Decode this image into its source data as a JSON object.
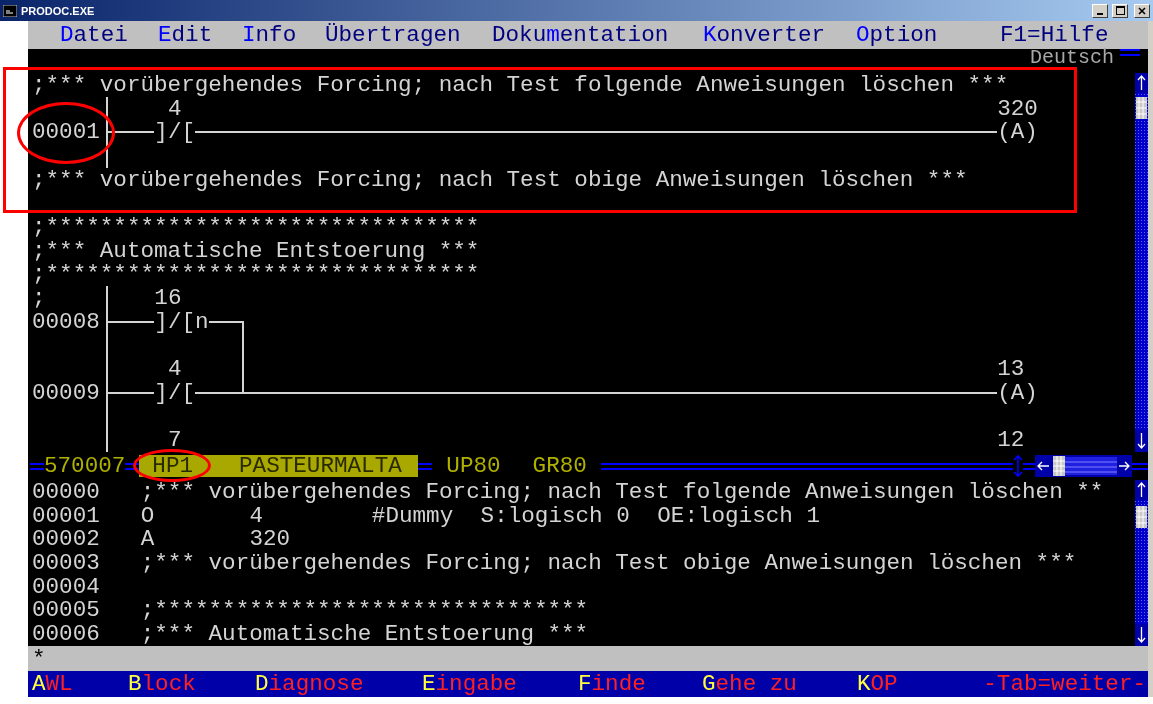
{
  "window": {
    "title": "PRODOC.EXE"
  },
  "menu": [
    {
      "hot": "D",
      "rest": "atei"
    },
    {
      "hot": "E",
      "rest": "dit"
    },
    {
      "hot": "I",
      "rest": "nfo"
    },
    {
      "rest": "Übertragen"
    },
    {
      "pre": "Doku",
      "hot": "m",
      "rest": "entation"
    },
    {
      "hot": "K",
      "rest": "onverter"
    },
    {
      "hot": "O",
      "rest": "ption"
    },
    {
      "rest": "F1=Hilfe"
    }
  ],
  "language": "Deutsch",
  "ladder": [
    {
      "kind": "comment",
      "text": ";*** vorübergehendes Forcing; nach Test folgende Anweisungen löschen ***"
    },
    {
      "kind": "network",
      "rungs": [
        {
          "number": "00001",
          "contact": {
            "operand": "4",
            "symbol": "]/["
          },
          "coil": {
            "operand": "320",
            "symbol": "(A)"
          }
        }
      ]
    },
    {
      "kind": "comment",
      "text": ";*** vorübergehendes Forcing; nach Test obige Anweisungen löschen ***"
    },
    {
      "kind": "blank"
    },
    {
      "kind": "comment",
      "text": ";********************************"
    },
    {
      "kind": "comment",
      "text": ";*** Automatische Entstoerung ***"
    },
    {
      "kind": "comment",
      "text": ";********************************"
    },
    {
      "kind": "network",
      "lead": ";",
      "rungs": [
        {
          "number": "00008",
          "contact": {
            "operand": "16",
            "symbol": "]/[n"
          }
        },
        {
          "number": "00009",
          "contact": {
            "operand": "4",
            "symbol": "]/["
          },
          "coil": {
            "operand": "13",
            "symbol": "(A)"
          }
        },
        {
          "contact": {
            "operand": "7"
          },
          "coil": {
            "operand": "12"
          }
        }
      ]
    }
  ],
  "status": {
    "address": "570007",
    "block": "HP1",
    "name": "PASTEURMALTA",
    "tags": [
      "UP80",
      "GR80"
    ]
  },
  "listing": [
    {
      "kind": "comment",
      "number": "00000",
      "text": ";*** vorübergehendes Forcing; nach Test folgende Anweisungen löschen **"
    },
    {
      "kind": "instruction",
      "number": "00001",
      "op": "O",
      "operand": "4",
      "symbol": "#Dummy",
      "comments": [
        "S:logisch 0",
        "OE:logisch 1"
      ]
    },
    {
      "kind": "instruction",
      "number": "00002",
      "op": "A",
      "operand": "320"
    },
    {
      "kind": "comment",
      "number": "00003",
      "text": ";*** vorübergehendes Forcing; nach Test obige Anweisungen löschen ***"
    },
    {
      "kind": "comment",
      "number": "00004"
    },
    {
      "kind": "comment",
      "number": "00005",
      "text": ";********************************"
    },
    {
      "kind": "comment",
      "number": "00006",
      "text": ";*** Automatische Entstoerung ***"
    }
  ],
  "command": {
    "value": "*"
  },
  "function_keys": [
    {
      "hot": "A",
      "rest": "WL"
    },
    {
      "hot": "B",
      "rest": "lock"
    },
    {
      "hot": "D",
      "rest": "iagnose"
    },
    {
      "hot": "E",
      "rest": "ingabe"
    },
    {
      "hot": "F",
      "rest": "inde"
    },
    {
      "hot": "G",
      "rest": "ehe zu"
    },
    {
      "hot": "K",
      "rest": "OP"
    }
  ],
  "tab_hint": "-Tab=weiter-"
}
